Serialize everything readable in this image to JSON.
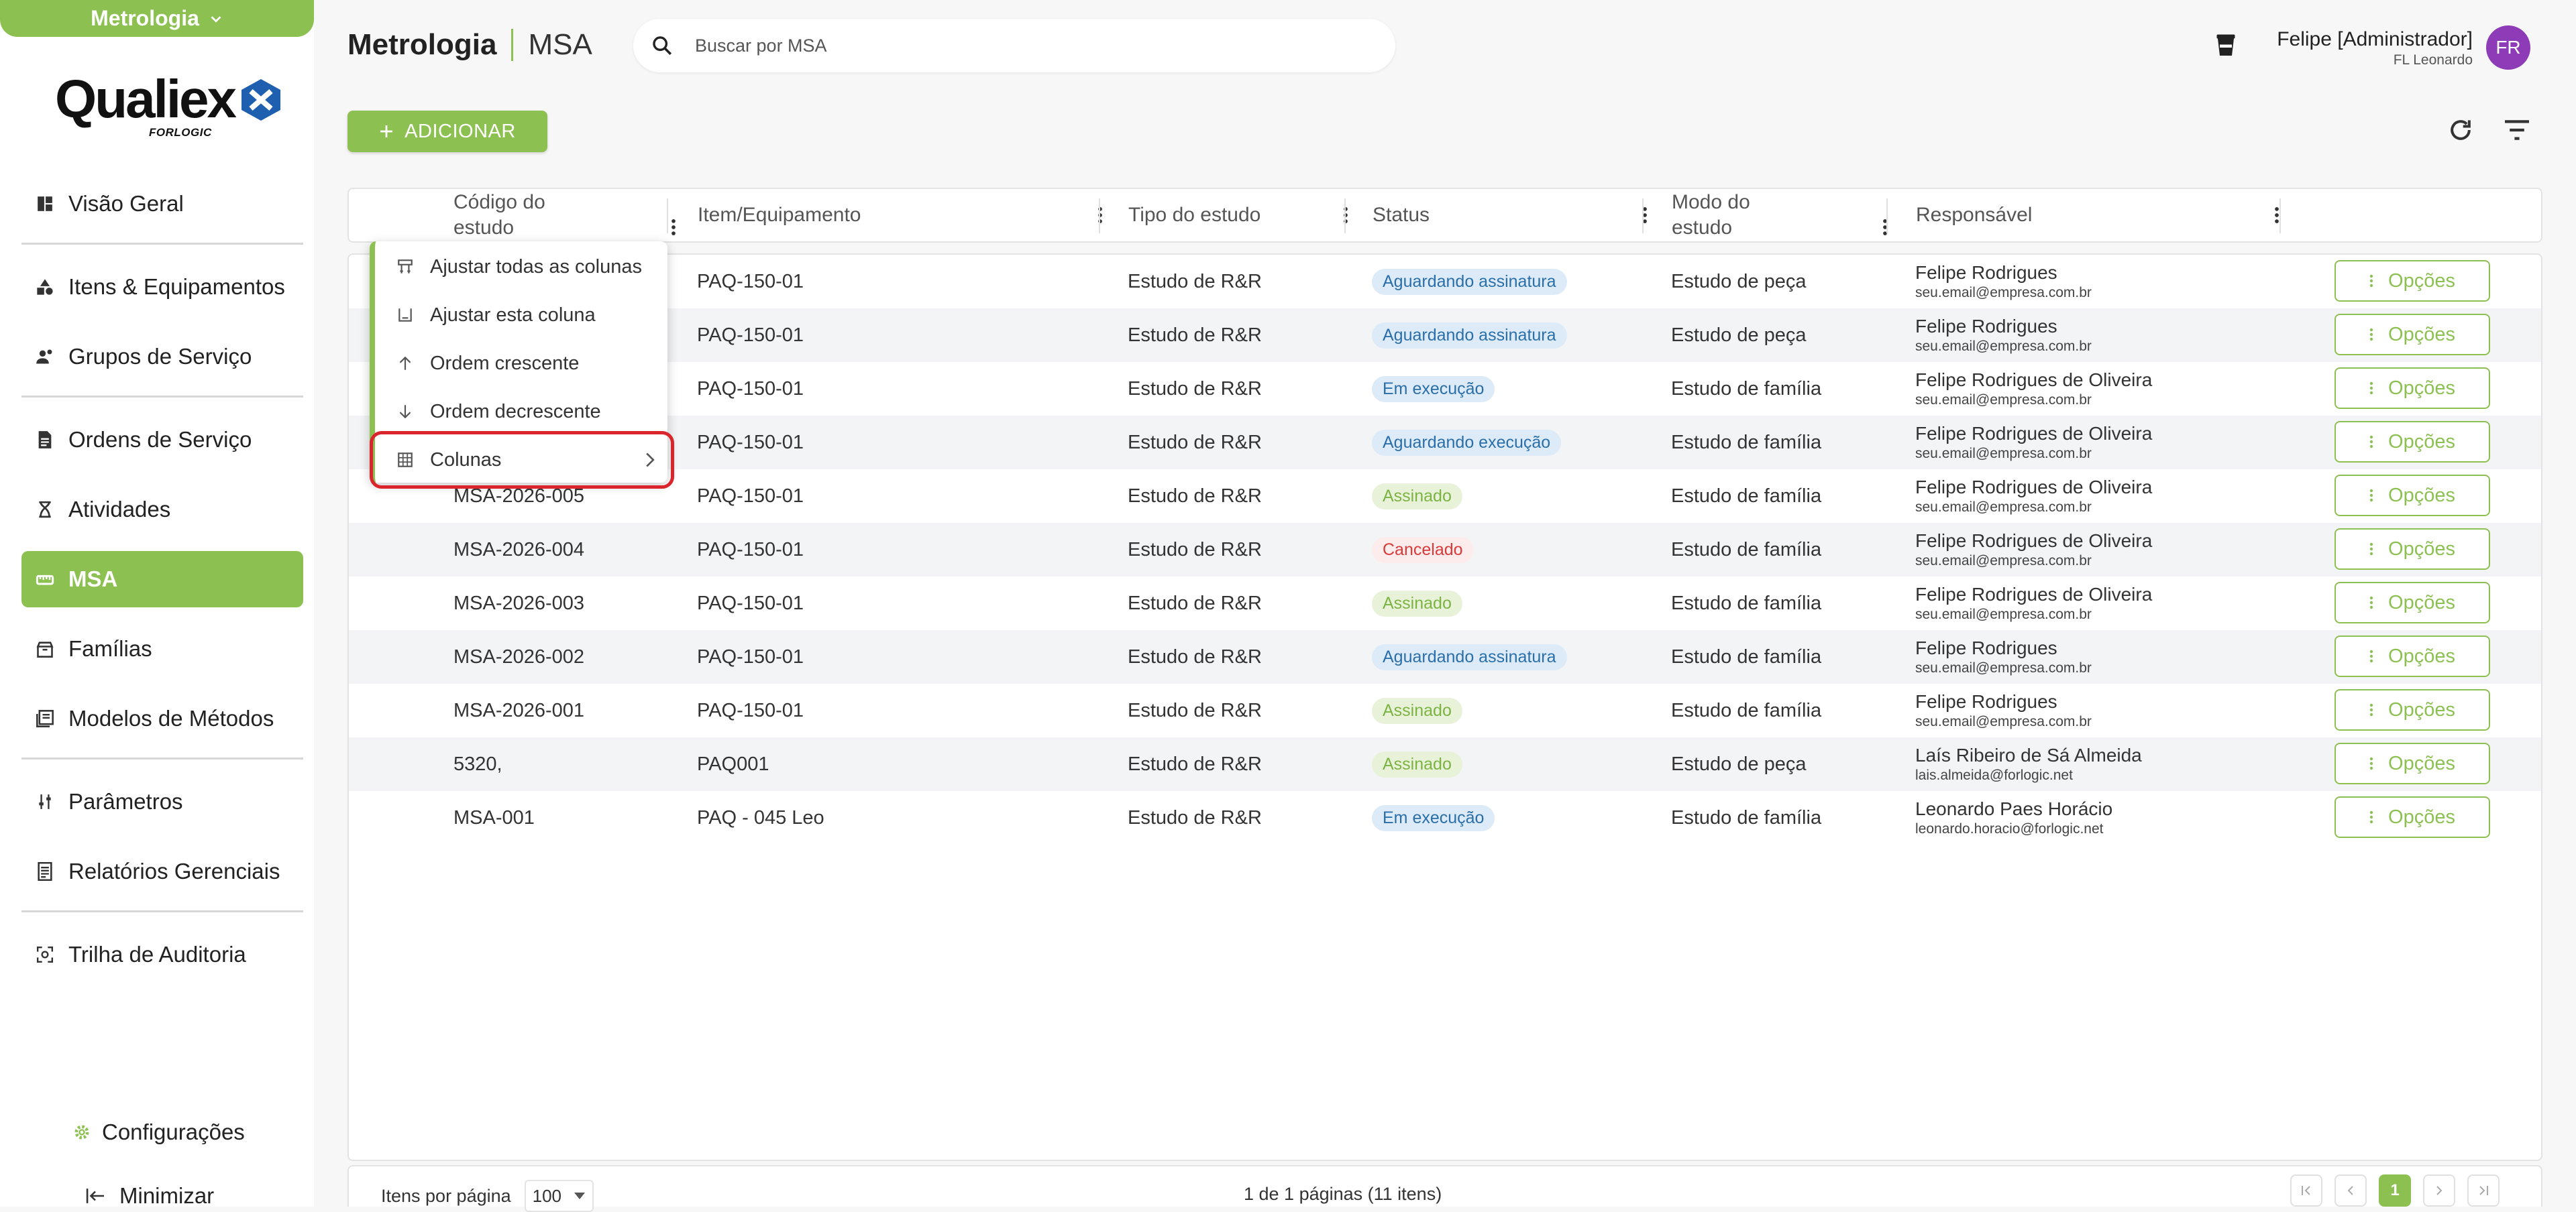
{
  "sidebar": {
    "module": "Metrologia",
    "logo": {
      "word": "Qualiex",
      "sub": "FORLOGIC"
    },
    "items": [
      {
        "label": "Visão Geral",
        "icon": "dashboard-icon"
      },
      {
        "label": "Itens & Equipamentos",
        "icon": "shapes-icon"
      },
      {
        "label": "Grupos de Serviço",
        "icon": "user-group-icon"
      },
      {
        "label": "Ordens de Serviço",
        "icon": "document-icon"
      },
      {
        "label": "Atividades",
        "icon": "hourglass-icon"
      },
      {
        "label": "MSA",
        "icon": "msa-icon",
        "active": true
      },
      {
        "label": "Famílias",
        "icon": "box-icon"
      },
      {
        "label": "Modelos de Métodos",
        "icon": "book-icon"
      },
      {
        "label": "Parâmetros",
        "icon": "sliders-icon"
      },
      {
        "label": "Relatórios Gerenciais",
        "icon": "report-icon"
      },
      {
        "label": "Trilha de Auditoria",
        "icon": "audit-icon"
      }
    ],
    "settings": "Configurações",
    "minimize": "Minimizar"
  },
  "header": {
    "module": "Metrologia",
    "page": "MSA",
    "search_placeholder": "Buscar por MSA",
    "user_name": "Felipe [Administrador]",
    "user_org": "FL Leonardo",
    "avatar": "FR"
  },
  "toolbar": {
    "add_label": "ADICIONAR"
  },
  "table": {
    "columns": [
      "Código do estudo",
      "Item/Equipamento",
      "Tipo do estudo",
      "Status",
      "Modo do estudo",
      "Responsável"
    ],
    "options_label": "Opções",
    "rows": [
      {
        "code": "",
        "item": "PAQ-150-01",
        "type": "Estudo de R&R",
        "status": "Aguardando assinatura",
        "status_kind": "blue",
        "mode": "Estudo de peça",
        "resp_name": "Felipe Rodrigues",
        "resp_email": "seu.email@empresa.com.br"
      },
      {
        "code": "",
        "item": "PAQ-150-01",
        "type": "Estudo de R&R",
        "status": "Aguardando assinatura",
        "status_kind": "blue",
        "mode": "Estudo de peça",
        "resp_name": "Felipe Rodrigues",
        "resp_email": "seu.email@empresa.com.br"
      },
      {
        "code": "",
        "item": "PAQ-150-01",
        "type": "Estudo de R&R",
        "status": "Em execução",
        "status_kind": "blue",
        "mode": "Estudo de família",
        "resp_name": "Felipe Rodrigues de Oliveira",
        "resp_email": "seu.email@empresa.com.br"
      },
      {
        "code": "",
        "item": "PAQ-150-01",
        "type": "Estudo de R&R",
        "status": "Aguardando execução",
        "status_kind": "blue",
        "mode": "Estudo de família",
        "resp_name": "Felipe Rodrigues de Oliveira",
        "resp_email": "seu.email@empresa.com.br"
      },
      {
        "code": "MSA-2026-005",
        "item": "PAQ-150-01",
        "type": "Estudo de R&R",
        "status": "Assinado",
        "status_kind": "green",
        "mode": "Estudo de família",
        "resp_name": "Felipe Rodrigues de Oliveira",
        "resp_email": "seu.email@empresa.com.br"
      },
      {
        "code": "MSA-2026-004",
        "item": "PAQ-150-01",
        "type": "Estudo de R&R",
        "status": "Cancelado",
        "status_kind": "red",
        "mode": "Estudo de família",
        "resp_name": "Felipe Rodrigues de Oliveira",
        "resp_email": "seu.email@empresa.com.br"
      },
      {
        "code": "MSA-2026-003",
        "item": "PAQ-150-01",
        "type": "Estudo de R&R",
        "status": "Assinado",
        "status_kind": "green",
        "mode": "Estudo de família",
        "resp_name": "Felipe Rodrigues de Oliveira",
        "resp_email": "seu.email@empresa.com.br"
      },
      {
        "code": "MSA-2026-002",
        "item": "PAQ-150-01",
        "type": "Estudo de R&R",
        "status": "Aguardando assinatura",
        "status_kind": "blue",
        "mode": "Estudo de família",
        "resp_name": "Felipe Rodrigues",
        "resp_email": "seu.email@empresa.com.br"
      },
      {
        "code": "MSA-2026-001",
        "item": "PAQ-150-01",
        "type": "Estudo de R&R",
        "status": "Assinado",
        "status_kind": "green",
        "mode": "Estudo de família",
        "resp_name": "Felipe Rodrigues",
        "resp_email": "seu.email@empresa.com.br"
      },
      {
        "code": "5320,",
        "item": "PAQ001",
        "type": "Estudo de R&R",
        "status": "Assinado",
        "status_kind": "green",
        "mode": "Estudo de peça",
        "resp_name": "Laís Ribeiro de Sá Almeida",
        "resp_email": "lais.almeida@forlogic.net"
      },
      {
        "code": "MSA-001",
        "item": "PAQ - 045 Leo",
        "type": "Estudo de R&R",
        "status": "Em execução",
        "status_kind": "blue",
        "mode": "Estudo de família",
        "resp_name": "Leonardo Paes Horácio",
        "resp_email": "leonardo.horacio@forlogic.net"
      }
    ]
  },
  "column_menu": {
    "items": [
      {
        "label": "Ajustar todas as colunas",
        "icon": "fit-all-columns-icon"
      },
      {
        "label": "Ajustar esta coluna",
        "icon": "fit-column-icon"
      },
      {
        "label": "Ordem crescente",
        "icon": "arrow-up-icon"
      },
      {
        "label": "Ordem decrescente",
        "icon": "arrow-down-icon"
      },
      {
        "label": "Colunas",
        "icon": "table-icon",
        "submenu": true
      }
    ]
  },
  "footer": {
    "items_per_page_label": "Itens por página",
    "items_per_page_value": "100",
    "page_info": "1 de 1 páginas (11 itens)",
    "current_page": "1"
  },
  "colors": {
    "accent": "#8cc152",
    "highlight": "#d9252b",
    "avatar": "#8e3bb8"
  }
}
